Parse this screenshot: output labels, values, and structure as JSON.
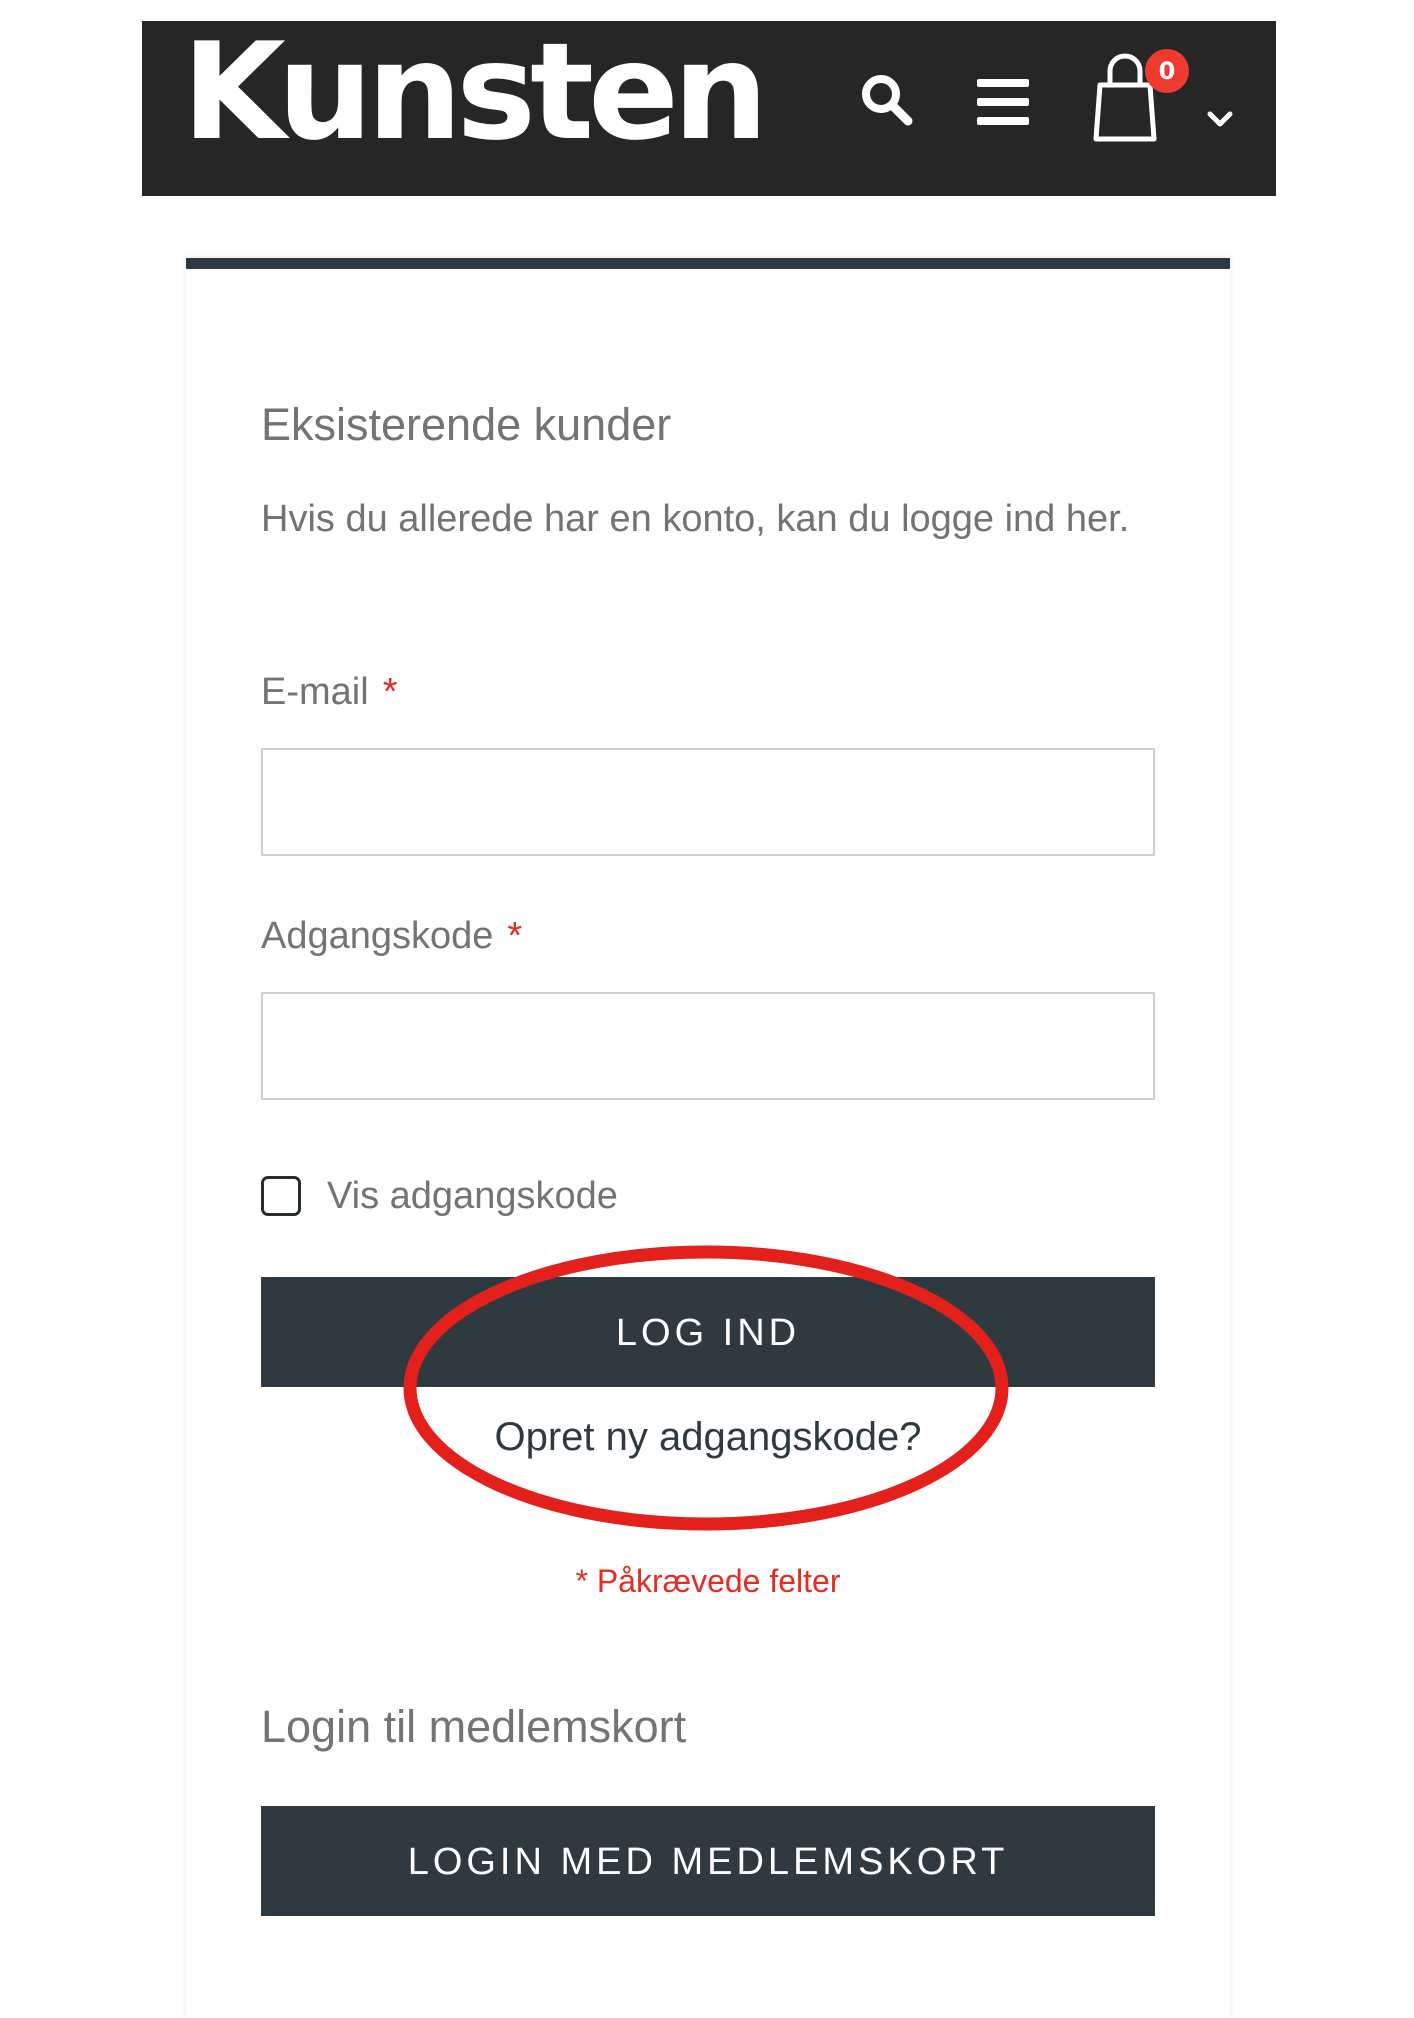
{
  "header": {
    "logo_text": "Kunsten",
    "cart_count": "0",
    "icons": [
      "search-icon",
      "menu-icon",
      "shopping-bag-icon",
      "chevron-down-icon"
    ],
    "background_color": "#262626",
    "badge_color": "#ef3a32"
  },
  "login": {
    "title": "Eksisterende kunder",
    "intro": "Hvis du allerede har en konto, kan du logge ind her.",
    "email_label": "E-mail",
    "email_value": "",
    "password_label": "Adgangskode",
    "password_value": "",
    "required_marker": "*",
    "show_password_label": "Vis adgangskode",
    "show_password_checked": false,
    "login_button": "LOG IND",
    "forgot_link": "Opret ny adgangskode?",
    "required_note": "* Påkrævede felter"
  },
  "member": {
    "title": "Login til medlemskort",
    "button": "LOGIN MED MEDLEMSKORT"
  },
  "colors": {
    "button": "#2e3a40",
    "required": "#e52b22",
    "annotation": "#e3201b"
  }
}
